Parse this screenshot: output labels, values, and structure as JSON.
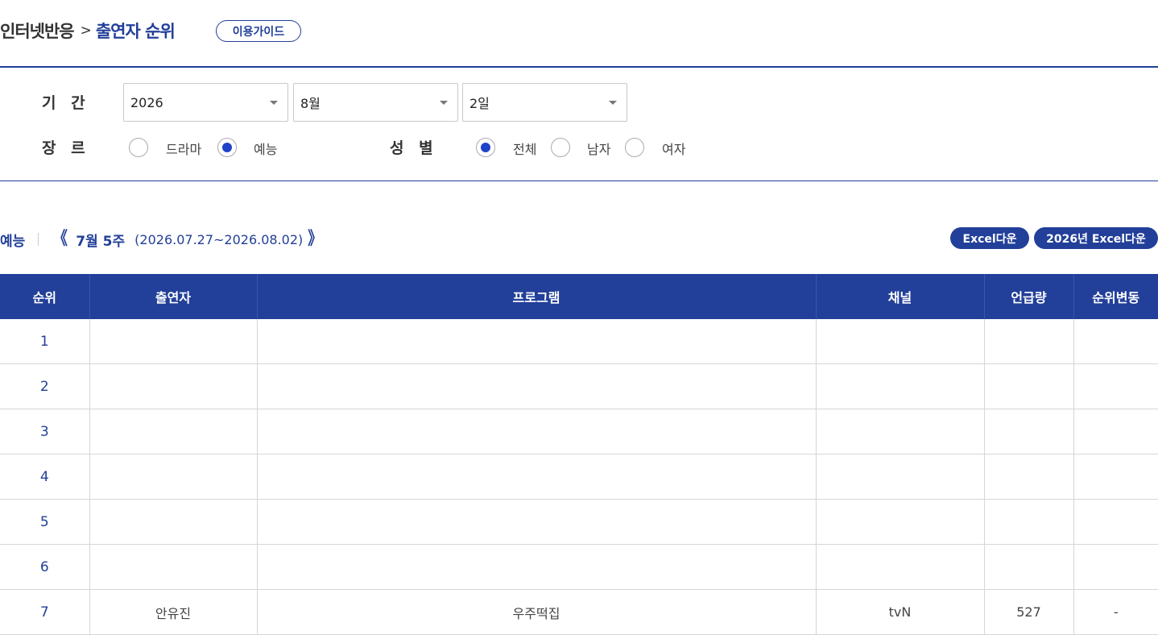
{
  "breadcrumb": {
    "parent": "인터넷반응",
    "separator": ">",
    "current": "출연자 순위"
  },
  "guide_button": "이용가이드",
  "filters": {
    "period_label": "기 간",
    "year": "2026",
    "month": "8월",
    "day": "2일",
    "genre_label": "장 르",
    "genre_options": [
      "드라마",
      "예능"
    ],
    "genre_selected": "예능",
    "gender_label": "성 별",
    "gender_options": [
      "전체",
      "남자",
      "여자"
    ],
    "gender_selected": "전체"
  },
  "week_nav": {
    "category": "예능",
    "prev_arrow": "《",
    "week": "7월 5주",
    "range": "(2026.07.27~2026.08.02)",
    "next_arrow": "》"
  },
  "buttons": {
    "excel": "Excel다운",
    "excel_year": "2026년 Excel다운"
  },
  "table": {
    "columns": [
      "순위",
      "출연자",
      "프로그램",
      "채널",
      "언급량",
      "순위변동"
    ],
    "rows": [
      [
        "1",
        "",
        "",
        "",
        "",
        ""
      ],
      [
        "2",
        "",
        "",
        "",
        "",
        ""
      ],
      [
        "3",
        "",
        "",
        "",
        "",
        ""
      ],
      [
        "4",
        "",
        "",
        "",
        "",
        ""
      ],
      [
        "5",
        "",
        "",
        "",
        "",
        ""
      ],
      [
        "6",
        "",
        "",
        "",
        "",
        ""
      ],
      [
        "7",
        "안유진",
        "우주떡집",
        "tvN",
        "527",
        "-"
      ]
    ]
  },
  "colors": {
    "primary": "#223f99",
    "radio_selected": "#1e43c9"
  }
}
